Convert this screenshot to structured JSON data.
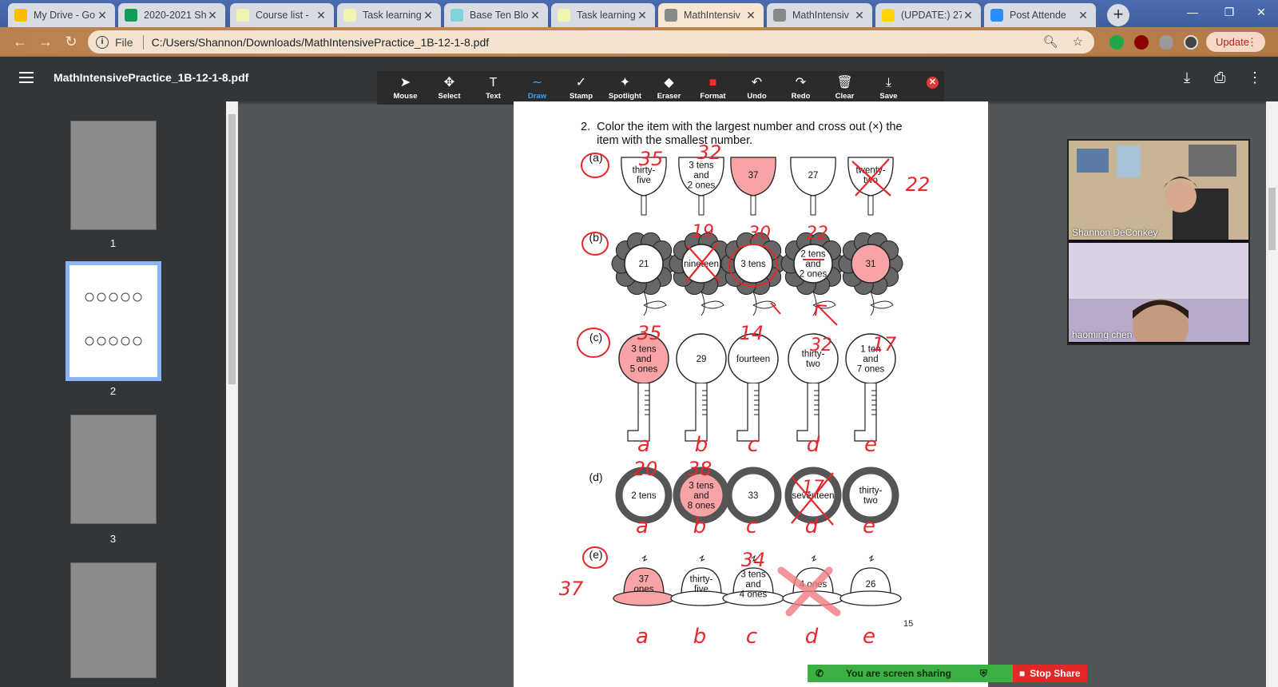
{
  "tabs": [
    {
      "title": "My Drive - Go",
      "fav": "drive-icon",
      "color": "#fbbc04"
    },
    {
      "title": "2020-2021 Sh",
      "fav": "sheets-icon",
      "color": "#0f9d58"
    },
    {
      "title": "Course list - ",
      "fav": "doc-icon",
      "color": "#f1f3b0"
    },
    {
      "title": "Task learning",
      "fav": "doc-icon",
      "color": "#f1f3b0"
    },
    {
      "title": "Base Ten Bloc",
      "fav": "robot-icon",
      "color": "#7fd3d9"
    },
    {
      "title": "Task learning",
      "fav": "doc-icon",
      "color": "#f1f3b0"
    },
    {
      "title": "MathIntensiv",
      "fav": "globe-icon",
      "color": "#888"
    },
    {
      "title": "MathIntensiv",
      "fav": "globe-icon",
      "color": "#888"
    },
    {
      "title": "(UPDATE:) 27",
      "fav": "news-icon",
      "color": "#ffd600"
    },
    {
      "title": "Post Attende",
      "fav": "zoom-icon",
      "color": "#2d8cff"
    }
  ],
  "address": {
    "protocol_label": "File",
    "url": "C:/Users/Shannon/Downloads/MathIntensivePractice_1B-12-1-8.pdf",
    "update_label": "Update"
  },
  "pdf": {
    "title": "MathIntensivePractice_1B-12-1-8.pdf"
  },
  "anno_tools": [
    {
      "label": "Mouse",
      "icon": "cursor-icon",
      "glyph": "➤"
    },
    {
      "label": "Select",
      "icon": "move-icon",
      "glyph": "✥"
    },
    {
      "label": "Text",
      "icon": "text-icon",
      "glyph": "T"
    },
    {
      "label": "Draw",
      "icon": "draw-icon",
      "glyph": "∼",
      "active": true
    },
    {
      "label": "Stamp",
      "icon": "check-icon",
      "glyph": "✓"
    },
    {
      "label": "Spotlight",
      "icon": "spotlight-icon",
      "glyph": "✦"
    },
    {
      "label": "Eraser",
      "icon": "eraser-icon",
      "glyph": "◆"
    },
    {
      "label": "Format",
      "icon": "format-icon",
      "glyph": "■"
    },
    {
      "label": "Undo",
      "icon": "undo-icon",
      "glyph": "↶"
    },
    {
      "label": "Redo",
      "icon": "redo-icon",
      "glyph": "↷"
    },
    {
      "label": "Clear",
      "icon": "trash-icon",
      "glyph": "🗑"
    },
    {
      "label": "Save",
      "icon": "save-icon",
      "glyph": "⤓"
    }
  ],
  "thumbs": [
    "1",
    "2",
    "3"
  ],
  "worksheet": {
    "question_num": "2.",
    "question_text": "Color the item with the largest number and cross out (×) the",
    "question_text2": "item with the smallest number.",
    "page_number": "15",
    "rows": [
      {
        "label": "(a)",
        "items": [
          "thirty-five",
          "3 tens and 2 ones",
          "37",
          "27",
          "twenty-two"
        ]
      },
      {
        "label": "(b)",
        "items": [
          "21",
          "nineteen",
          "3 tens",
          "2 tens and 2 ones",
          "31"
        ]
      },
      {
        "label": "(c)",
        "items": [
          "3 tens and 5 ones",
          "29",
          "fourteen",
          "thirty-two",
          "1 ten and 7 ones"
        ]
      },
      {
        "label": "(d)",
        "items": [
          "2 tens",
          "3 tens and 8 ones",
          "33",
          "seventeen",
          "thirty-two"
        ]
      },
      {
        "label": "(e)",
        "items": [
          "37 ones",
          "thirty-five",
          "3 tens and 4 ones",
          "4 ones",
          "26"
        ]
      }
    ],
    "handwritten": {
      "a": [
        "35",
        "32",
        "22"
      ],
      "b": [
        "19",
        "30",
        "22"
      ],
      "c": [
        "35",
        "14",
        "32",
        "17"
      ],
      "d": [
        "20",
        "38",
        "17"
      ],
      "e": [
        "34",
        "37"
      ],
      "letters": [
        "a",
        "b",
        "c",
        "d",
        "e"
      ]
    }
  },
  "video": {
    "p1": "Shannon DeConkey",
    "p2": "haoming chen"
  },
  "share": {
    "status": "You are screen sharing",
    "stop": "Stop Share"
  }
}
